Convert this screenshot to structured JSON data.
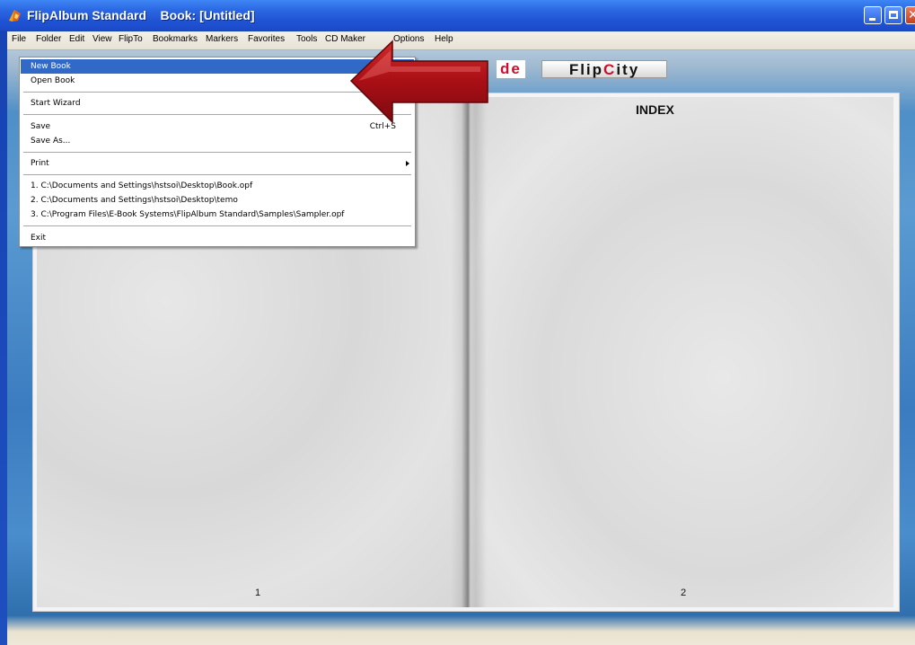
{
  "window": {
    "title": "FlipAlbum Standard    Book: [Untitled]"
  },
  "menubar": [
    {
      "label": "File"
    },
    {
      "label": "Folder"
    },
    {
      "label": "Edit"
    },
    {
      "label": "View"
    },
    {
      "label": "FlipTo"
    },
    {
      "label": "Bookmarks"
    },
    {
      "label": "Markers"
    },
    {
      "label": "Favorites"
    },
    {
      "label": "Tools"
    },
    {
      "label": "CD Maker"
    },
    {
      "label": "Options"
    },
    {
      "label": "Help"
    }
  ],
  "file_menu": {
    "new_book": "New Book",
    "open_book": "Open Book",
    "start_wizard": "Start Wizard",
    "save": "Save",
    "save_shortcut": "Ctrl+S",
    "save_as": "Save As...",
    "print": "Print",
    "recent": [
      "1. C:\\Documents and Settings\\hstsoi\\Desktop\\Book.opf",
      "2. C:\\Documents and Settings\\hstsoi\\Desktop\\temo",
      "3. C:\\Program Files\\E-Book Systems\\FlipAlbum Standard\\Samples\\Sampler.opf"
    ],
    "exit": "Exit"
  },
  "logo": {
    "left_text": "de",
    "flip_text": "Flip",
    "city_c": "C",
    "city_rest": "ity"
  },
  "book": {
    "right_title": "INDEX",
    "left_page_number": "1",
    "right_page_number": "2"
  },
  "colors": {
    "titlebar": "#2a66e2",
    "menu_highlight": "#3169c6",
    "arrow": "#b5121b"
  },
  "icons": [
    "flipalbum-app-icon",
    "minimize-icon",
    "maximize-icon",
    "close-icon",
    "red-pointer-arrow",
    "submenu-arrow-icon"
  ]
}
